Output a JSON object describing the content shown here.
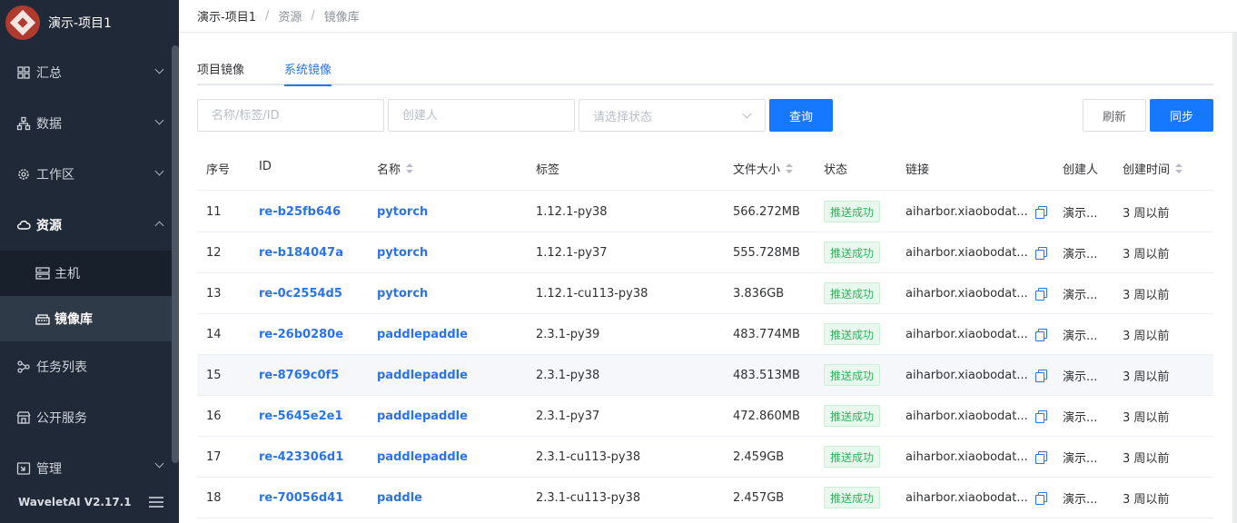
{
  "app": {
    "project_title": "演示-项目1",
    "version": "WaveletAI V2.17.1"
  },
  "sidebar": {
    "items": [
      {
        "label": "汇总",
        "icon": "grid-icon"
      },
      {
        "label": "数据",
        "icon": "hierarchy-icon"
      },
      {
        "label": "工作区",
        "icon": "gear-icon"
      },
      {
        "label": "资源",
        "icon": "cloud-icon",
        "expanded": true,
        "children": [
          {
            "label": "主机",
            "icon": "server-icon"
          },
          {
            "label": "镜像库",
            "icon": "image-registry-icon",
            "selected": true
          }
        ]
      },
      {
        "label": "任务列表",
        "icon": "tasks-icon"
      },
      {
        "label": "公开服务",
        "icon": "store-icon"
      },
      {
        "label": "管理",
        "icon": "manage-icon"
      }
    ]
  },
  "breadcrumb": [
    "演示-项目1",
    "资源",
    "镜像库"
  ],
  "tabs": [
    {
      "label": "项目镜像"
    },
    {
      "label": "系统镜像",
      "active": true
    }
  ],
  "filters": {
    "name_placeholder": "名称/标签/ID",
    "creator_placeholder": "创建人",
    "status_placeholder": "请选择状态",
    "query_label": "查询",
    "refresh_label": "刷新",
    "sync_label": "同步"
  },
  "table": {
    "columns": [
      "序号",
      "ID",
      "名称",
      "标签",
      "文件大小",
      "状态",
      "链接",
      "创建人",
      "创建时间"
    ],
    "rows": [
      {
        "no": "11",
        "id": "re-b25fb646",
        "name": "pytorch",
        "tag": "1.12.1-py38",
        "size": "566.272MB",
        "status": "推送成功",
        "link": "aiharbor.xiaobodat...",
        "creator": "演示...",
        "created": "3 周以前"
      },
      {
        "no": "12",
        "id": "re-b184047a",
        "name": "pytorch",
        "tag": "1.12.1-py37",
        "size": "555.728MB",
        "status": "推送成功",
        "link": "aiharbor.xiaobodat...",
        "creator": "演示...",
        "created": "3 周以前"
      },
      {
        "no": "13",
        "id": "re-0c2554d5",
        "name": "pytorch",
        "tag": "1.12.1-cu113-py38",
        "size": "3.836GB",
        "status": "推送成功",
        "link": "aiharbor.xiaobodat...",
        "creator": "演示...",
        "created": "3 周以前"
      },
      {
        "no": "14",
        "id": "re-26b0280e",
        "name": "paddlepaddle",
        "tag": "2.3.1-py39",
        "size": "483.774MB",
        "status": "推送成功",
        "link": "aiharbor.xiaobodat...",
        "creator": "演示...",
        "created": "3 周以前"
      },
      {
        "no": "15",
        "id": "re-8769c0f5",
        "name": "paddlepaddle",
        "tag": "2.3.1-py38",
        "size": "483.513MB",
        "status": "推送成功",
        "link": "aiharbor.xiaobodat...",
        "creator": "演示...",
        "created": "3 周以前"
      },
      {
        "no": "16",
        "id": "re-5645e2e1",
        "name": "paddlepaddle",
        "tag": "2.3.1-py37",
        "size": "472.860MB",
        "status": "推送成功",
        "link": "aiharbor.xiaobodat...",
        "creator": "演示...",
        "created": "3 周以前"
      },
      {
        "no": "17",
        "id": "re-423306d1",
        "name": "paddlepaddle",
        "tag": "2.3.1-cu113-py38",
        "size": "2.459GB",
        "status": "推送成功",
        "link": "aiharbor.xiaobodat...",
        "creator": "演示...",
        "created": "3 周以前"
      },
      {
        "no": "18",
        "id": "re-70056d41",
        "name": "paddle",
        "tag": "2.3.1-cu113-py38",
        "size": "2.457GB",
        "status": "推送成功",
        "link": "aiharbor.xiaobodat...",
        "creator": "演示...",
        "created": "3 周以前"
      }
    ]
  }
}
